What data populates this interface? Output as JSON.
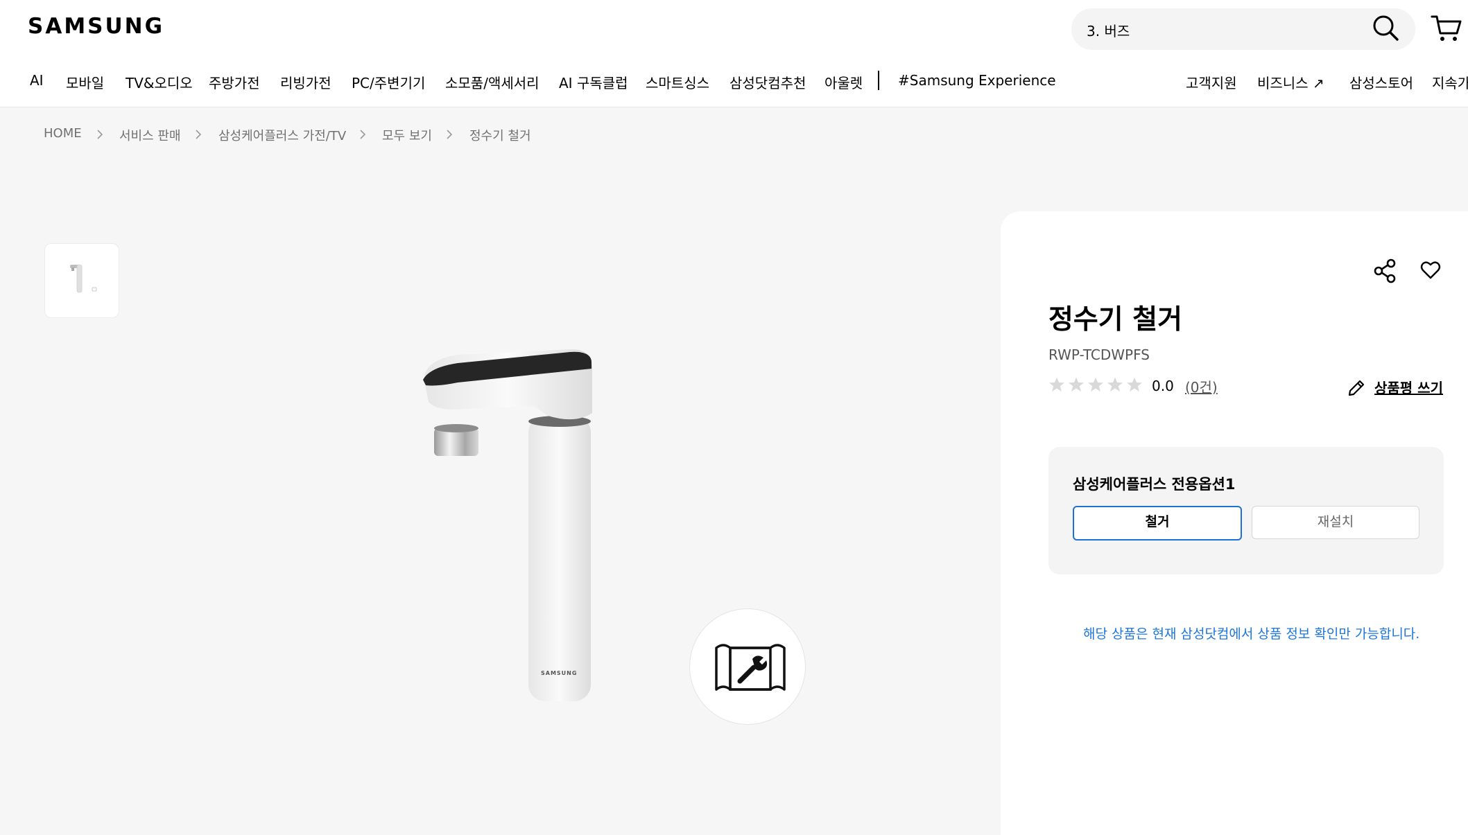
{
  "header": {
    "logo": "SAMSUNG",
    "search_value": "3. 버즈",
    "nav_left": [
      "AI",
      "모바일",
      "TV&오디오",
      "주방가전",
      "리빙가전",
      "PC/주변기기",
      "소모품/액세서리",
      "AI 구독클럽",
      "스마트싱스",
      "삼성닷컴추천",
      "아울렛"
    ],
    "nav_experience": "#Samsung Experience",
    "nav_right": [
      "고객지원",
      "비즈니스 ↗",
      "삼성스토어",
      "지속가"
    ]
  },
  "breadcrumb": [
    "HOME",
    "서비스 판매",
    "삼성케어플러스 가전/TV",
    "모두 보기",
    "정수기 철거"
  ],
  "product": {
    "title": "정수기 철거",
    "model": "RWP-TCDWPFS",
    "rating": "0.0",
    "rating_value": 0,
    "rating_max": 5,
    "review_count": "(0건)",
    "write_review": "상품평 쓰기",
    "brand_on_product": "SAMSUNG"
  },
  "options": {
    "title": "삼성케어플러스 전용옵션1",
    "choices": [
      "철거",
      "재설치"
    ],
    "selected_index": 0
  },
  "notice": "해당 상품은 현재 삼성닷컴에서 상품 정보 확인만 가능합니다.",
  "colors": {
    "accent": "#1e6fd9",
    "notice": "#1d76dc",
    "background": "#f6f6f6"
  },
  "icons": {
    "search": "search-icon",
    "cart": "cart-icon",
    "share": "share-icon",
    "wishlist": "heart-icon",
    "write": "pencil-icon",
    "ar_view": "installation-guide-icon"
  }
}
